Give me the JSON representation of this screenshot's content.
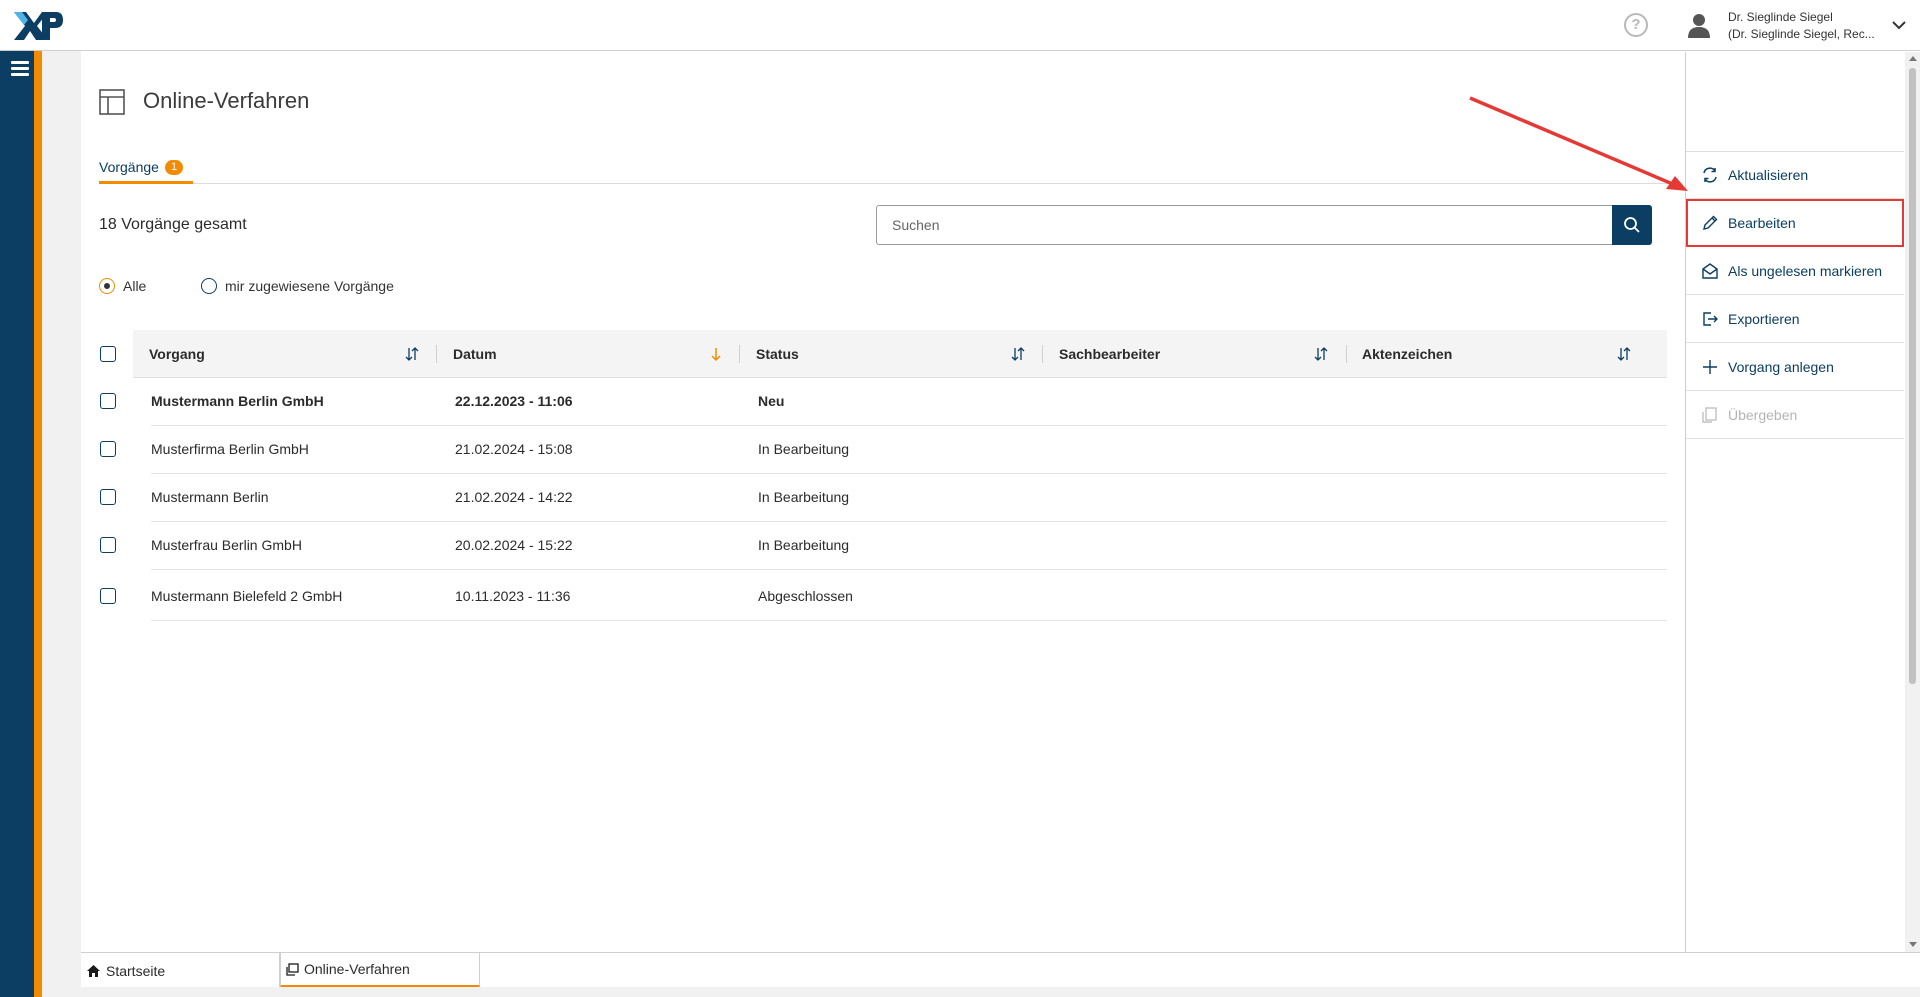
{
  "header": {
    "logo_text": "XP",
    "help_icon": "question-circle-icon",
    "user_name": "Dr. Sieglinde Siegel",
    "user_subtitle": "(Dr. Sieglinde Siegel, Rec...",
    "user_icon": "user-icon",
    "chevron_icon": "chevron-down-icon"
  },
  "nav": {
    "menu_icon": "hamburger-menu-icon"
  },
  "page": {
    "title": "Online-Verfahren",
    "icon": "layout-icon"
  },
  "tabs": [
    {
      "label": "Vorgänge",
      "badge": "1",
      "active": true
    }
  ],
  "summary": {
    "total": "18 Vorgänge gesamt"
  },
  "search": {
    "placeholder": "Suchen",
    "value": "",
    "icon": "search-icon"
  },
  "filters": [
    {
      "label": "Alle",
      "checked": true
    },
    {
      "label": "mir zugewiesene Vorgänge",
      "checked": false
    }
  ],
  "table": {
    "columns": [
      {
        "label": "Vorgang",
        "sort": "sort-both-icon"
      },
      {
        "label": "Datum",
        "sort": "sort-down-icon"
      },
      {
        "label": "Status",
        "sort": "sort-both-icon"
      },
      {
        "label": "Sachbearbeiter",
        "sort": "sort-both-icon"
      },
      {
        "label": "Aktenzeichen",
        "sort": "sort-both-icon"
      }
    ],
    "rows": [
      {
        "vorgang": "Mustermann Berlin GmbH",
        "datum": "22.12.2023 - 11:06",
        "status": "Neu",
        "sachbearbeiter": "",
        "aktenzeichen": "",
        "unread": true
      },
      {
        "vorgang": "Musterfirma Berlin GmbH",
        "datum": "21.02.2024 - 15:08",
        "status": "In Bearbeitung",
        "sachbearbeiter": "",
        "aktenzeichen": "",
        "unread": false
      },
      {
        "vorgang": "Mustermann Berlin",
        "datum": "21.02.2024 - 14:22",
        "status": "In Bearbeitung",
        "sachbearbeiter": "",
        "aktenzeichen": "",
        "unread": false
      },
      {
        "vorgang": "Musterfrau Berlin GmbH",
        "datum": "20.02.2024 - 15:22",
        "status": "In Bearbeitung",
        "sachbearbeiter": "",
        "aktenzeichen": "",
        "unread": false
      },
      {
        "vorgang": "Mustermann Bielefeld 2 GmbH",
        "datum": "10.11.2023 - 11:36",
        "status": "Abgeschlossen",
        "sachbearbeiter": "",
        "aktenzeichen": "",
        "unread": false
      }
    ]
  },
  "actions": [
    {
      "label": "Aktualisieren",
      "icon": "refresh-icon",
      "disabled": false,
      "highlighted": false
    },
    {
      "label": "Bearbeiten",
      "icon": "pencil-icon",
      "disabled": false,
      "highlighted": true
    },
    {
      "label": "Als ungelesen markieren",
      "icon": "mail-open-icon",
      "disabled": false,
      "highlighted": false
    },
    {
      "label": "Exportieren",
      "icon": "export-icon",
      "disabled": false,
      "highlighted": false
    },
    {
      "label": "Vorgang anlegen",
      "icon": "plus-icon",
      "disabled": false,
      "highlighted": false
    },
    {
      "label": "Übergeben",
      "icon": "handover-icon",
      "disabled": true,
      "highlighted": false
    }
  ],
  "bottom_tabs": [
    {
      "label": "Startseite",
      "icon": "home-icon",
      "active": false
    },
    {
      "label": "Online-Verfahren",
      "icon": "window-icon",
      "active": true
    }
  ],
  "colors": {
    "brand_dark": "#0c3d62",
    "accent": "#f28b00",
    "highlight": "#e53935"
  }
}
